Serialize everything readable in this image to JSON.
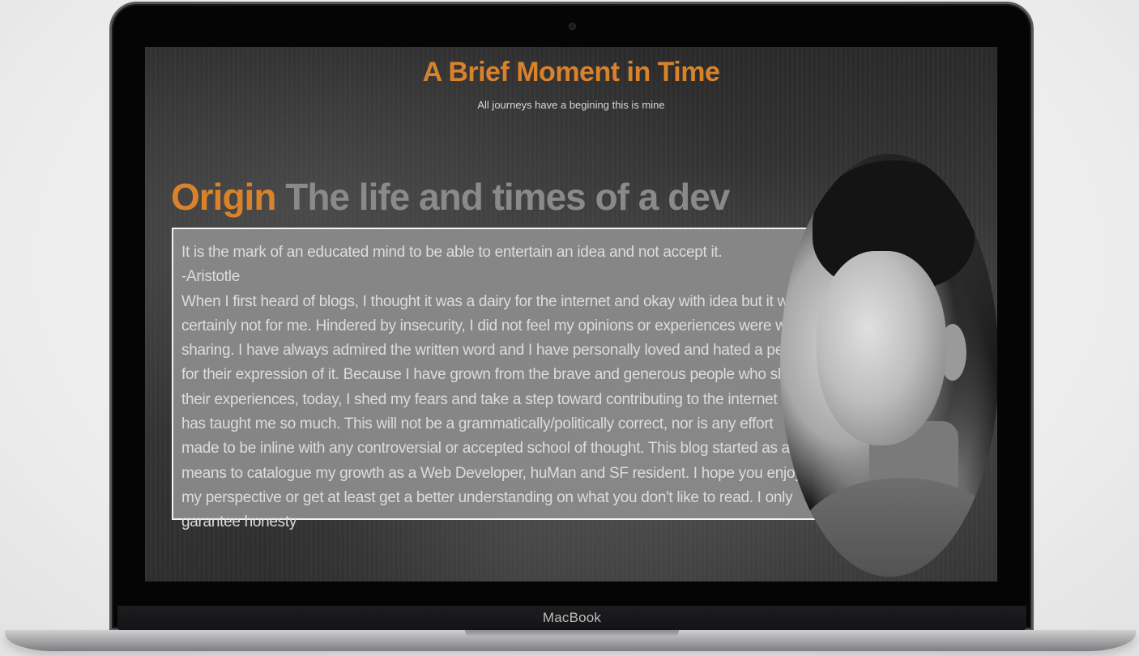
{
  "site": {
    "title": "A Brief Moment in Time",
    "subtitle": "All journeys have a begining this is mine"
  },
  "section": {
    "heading_accent": "Origin",
    "heading_rest": "The life and times of a dev",
    "quote": "It is the mark of an educated mind to be able to entertain an idea and not accept it.",
    "quote_author": "-Aristotle",
    "body": "When I first heard of blogs, I thought it was a dairy for the internet and okay with idea but it was certainly not for me. Hindered by insecurity, I did not feel my opinions or experiences were worth sharing. I have always admired the written word and I have personally loved and hated a person for their expression of it. Because I have grown from the brave and generous people who share their experiences, today, I shed my fears and take a step toward contributing to the internet that has taught me so much. This will not be a grammatically/politically correct, nor is any effort made to be inline with any controversial or accepted school of thought. This blog started as a means to catalogue my growth as a Web Developer, huMan and SF resident. I hope you enjoy my perspective or get at least get a better understanding on what you don't like to read. I only garantee honesty"
  },
  "device": {
    "label": "MacBook"
  },
  "colors": {
    "accent": "#d9822b",
    "box_background": "#8c8c8c"
  }
}
